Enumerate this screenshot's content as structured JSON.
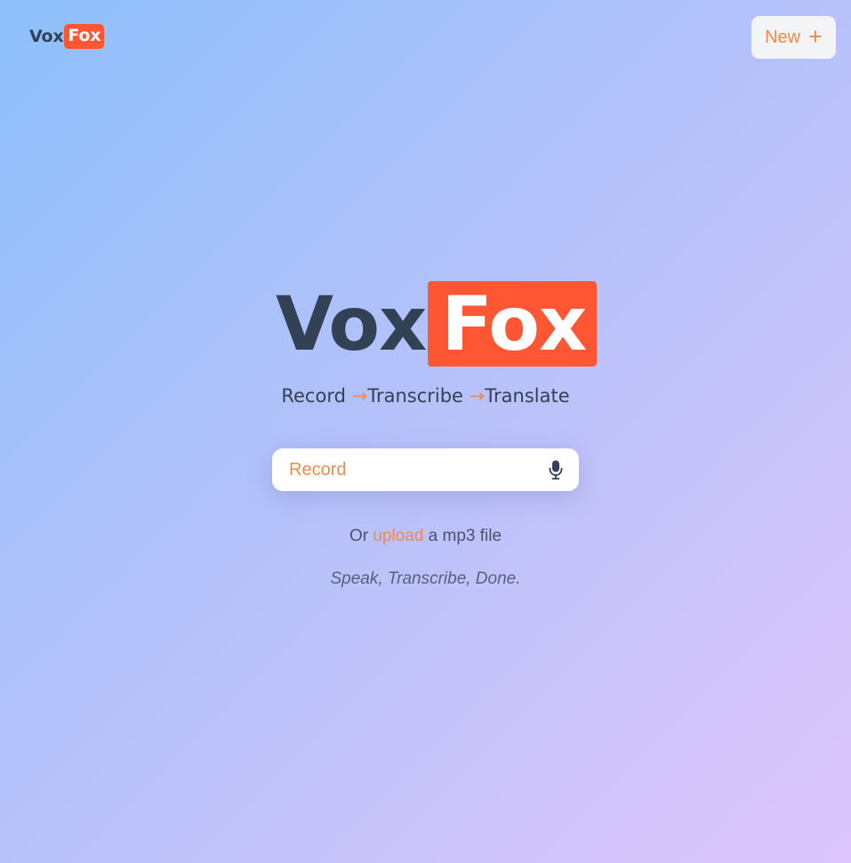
{
  "header": {
    "logo": {
      "part1": "Vox",
      "part2": "Fox"
    },
    "new_button": {
      "label": "New",
      "icon": "plus-icon",
      "icon_glyph": "+"
    }
  },
  "hero": {
    "title": {
      "part1": "Vox",
      "part2": "Fox"
    },
    "tagline": {
      "step1": "Record",
      "arrow": "→",
      "step2": "Transcribe",
      "step3": "Translate"
    }
  },
  "record": {
    "label": "Record",
    "icon": "microphone-icon"
  },
  "upload": {
    "prefix": "Or",
    "link": "upload",
    "suffix": "a mp3 file"
  },
  "motto": "Speak, Transcribe, Done.",
  "colors": {
    "accent": "#ff5733",
    "accent_text": "#f08a4b",
    "text_dark": "#334155",
    "background_start": "#8dc0fb",
    "background_end": "#dcc5fb"
  }
}
